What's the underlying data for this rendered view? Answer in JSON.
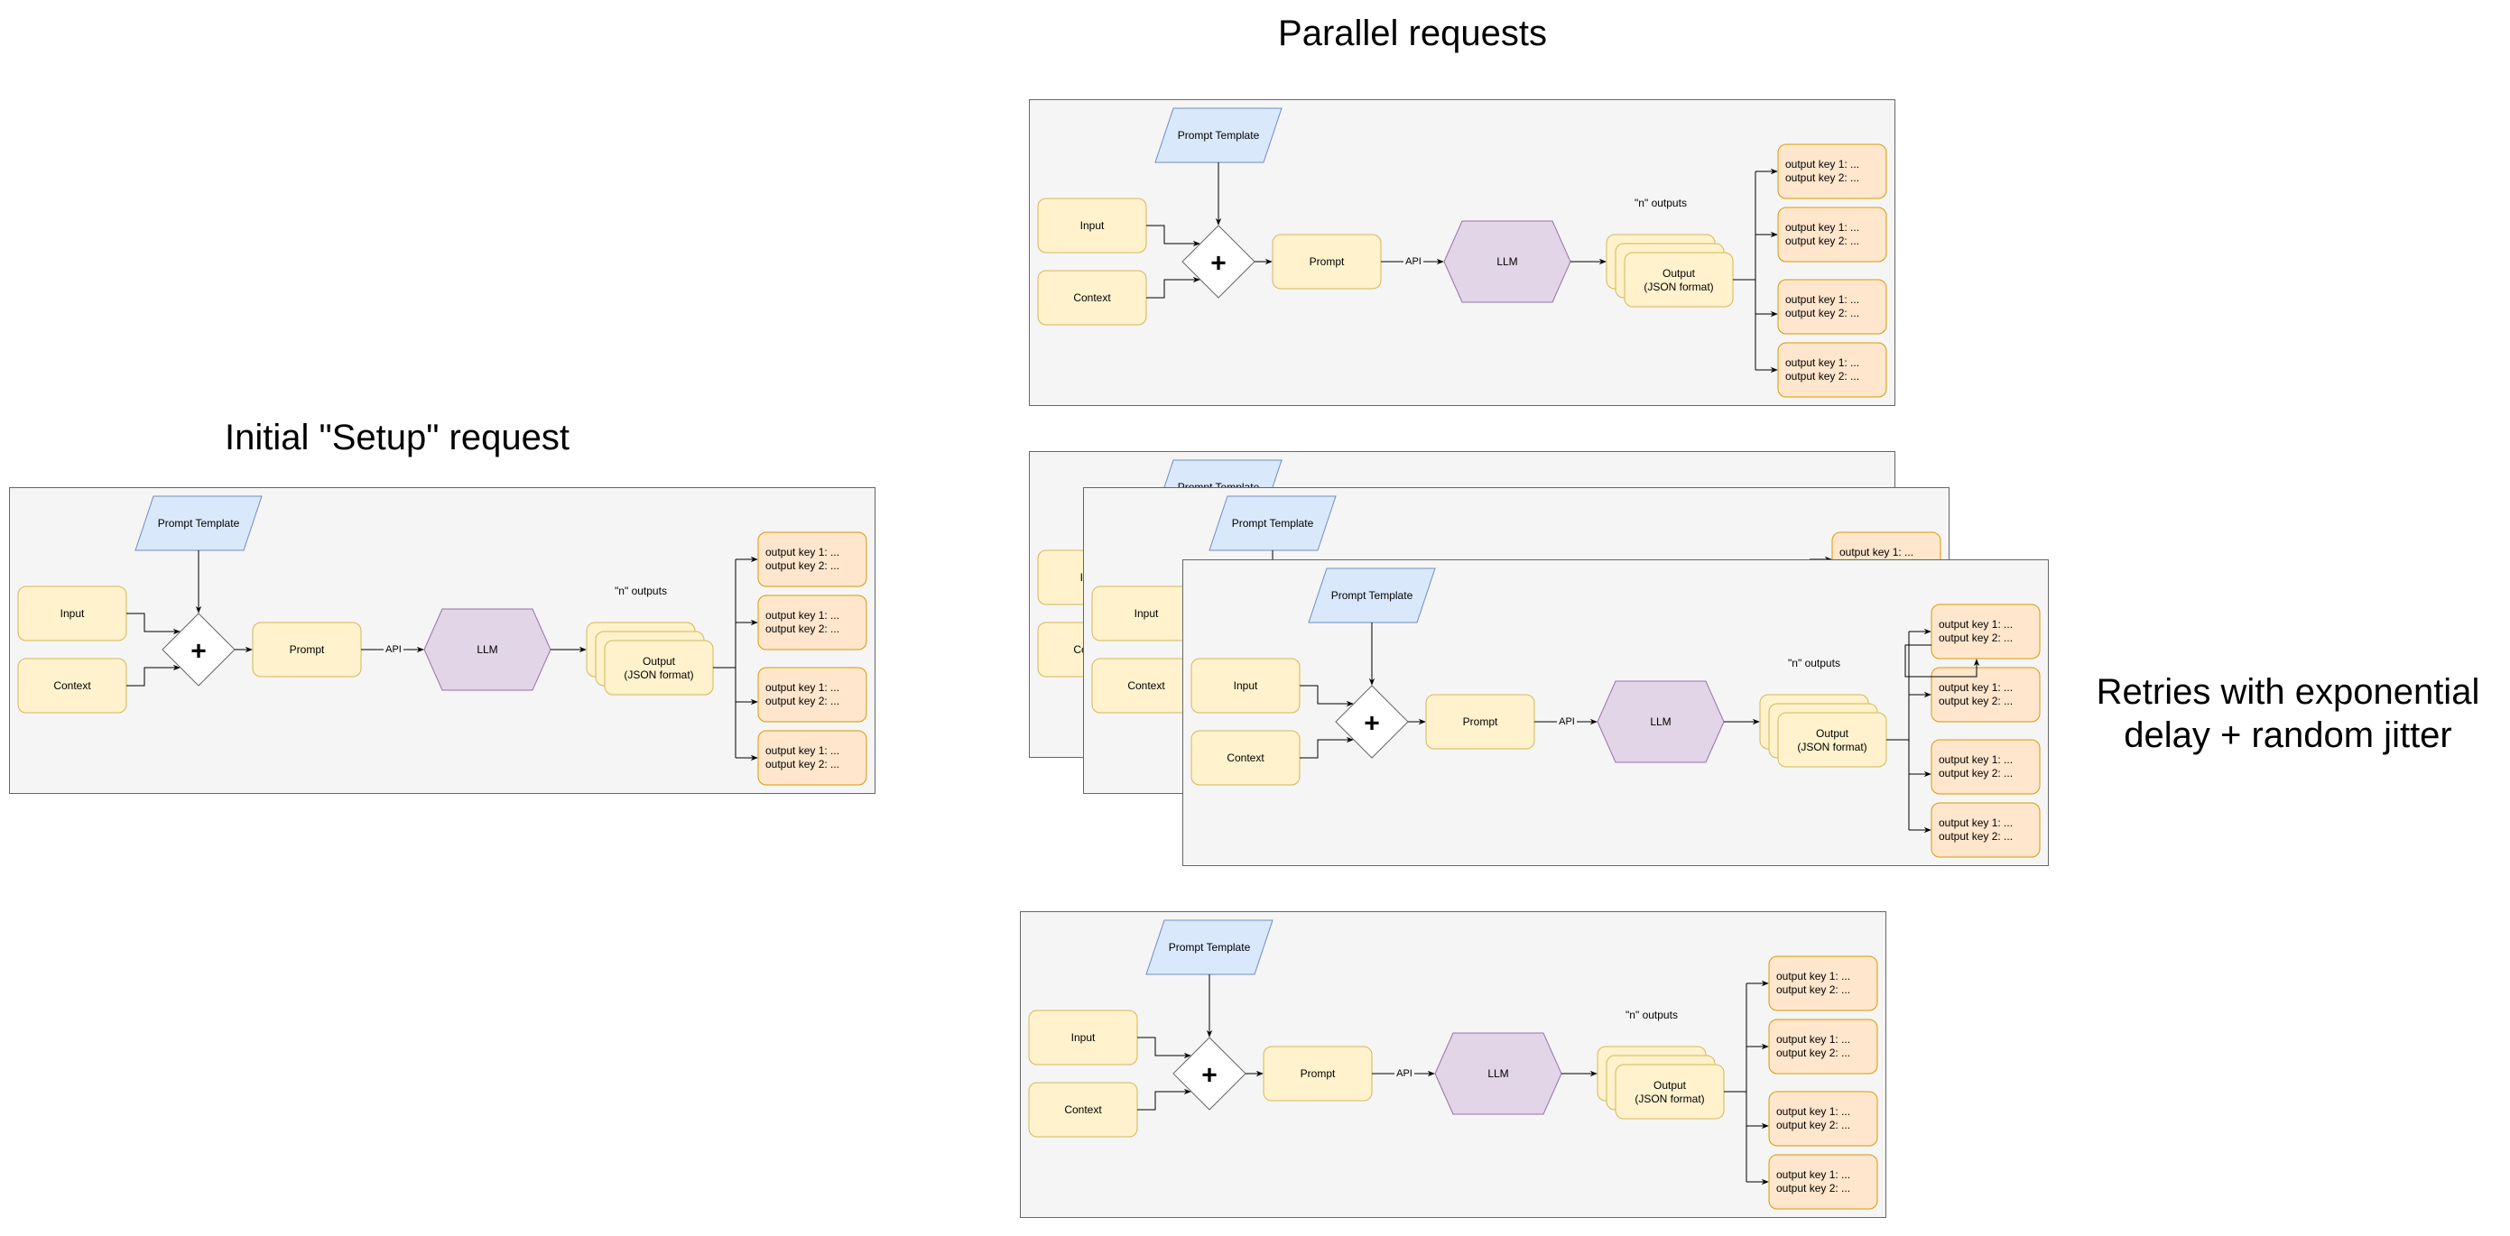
{
  "titles": {
    "setup": "Initial \"Setup\" request",
    "parallel": "Parallel requests",
    "retries": "Retries with exponential\ndelay + random jitter"
  },
  "colors": {
    "panel_fill": "#f5f5f5",
    "panel_stroke": "#666666",
    "yellow_fill": "#fff2cc",
    "yellow_stroke": "#d6b656",
    "orange_fill": "#ffe6cc",
    "orange_stroke": "#d79b00",
    "blue_fill": "#dae8fc",
    "blue_stroke": "#6c8ebf",
    "purple_fill": "#e1d5e7",
    "purple_stroke": "#9673a6",
    "diamond_fill": "#ffffff",
    "diamond_stroke": "#666666"
  },
  "flow": {
    "prompt_template": "Prompt Template",
    "input": "Input",
    "context": "Context",
    "combine_symbol": "+",
    "prompt": "Prompt",
    "api_label": "API",
    "llm": "LLM",
    "n_outputs_label": "\"n\" outputs",
    "output_line1": "Output",
    "output_line2": "(JSON format)",
    "output_key_line1": "output key 1: ...",
    "output_key_line2": "output key 2: ...",
    "output_key_count": 4
  },
  "panels": [
    {
      "id": "setup-panel",
      "group": "setup"
    },
    {
      "id": "parallel-panel",
      "group": "parallel"
    },
    {
      "id": "retry-panel-1",
      "group": "retries"
    },
    {
      "id": "retry-panel-2",
      "group": "retries"
    },
    {
      "id": "retry-panel-3",
      "group": "retries",
      "has_retry_loop": true
    },
    {
      "id": "parallel-panel-bottom",
      "group": "parallel"
    }
  ]
}
